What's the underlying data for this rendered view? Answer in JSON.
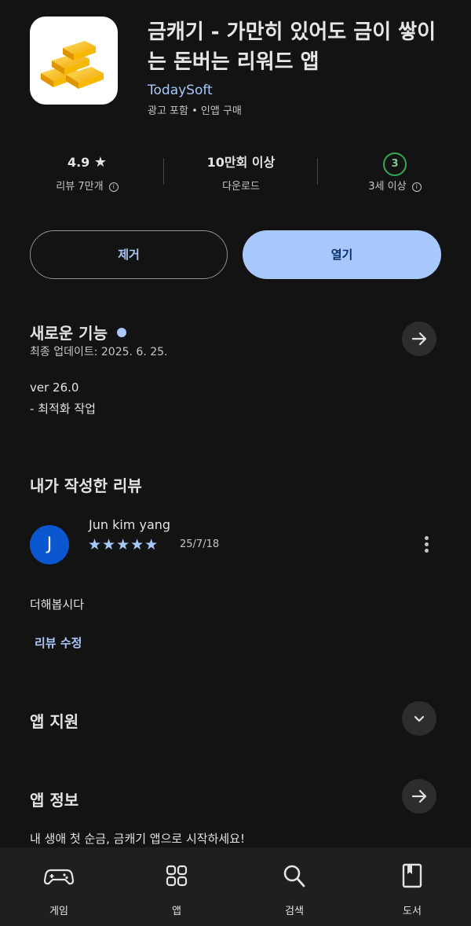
{
  "app": {
    "title": "금캐기 - 가만히 있어도 금이 쌓이는 돈버는 리워드 앱",
    "developer": "TodaySoft",
    "subtitle": "광고 포함 • 인앱 구매"
  },
  "stats": {
    "rating": "4.9",
    "rating_star": "★",
    "reviews_label": "리뷰 7만개",
    "downloads": "10만회 이상",
    "downloads_label": "다운로드",
    "age_badge": "3",
    "age_label": "3세 이상",
    "info_glyph": "i"
  },
  "buttons": {
    "remove": "제거",
    "open": "열기"
  },
  "whats_new": {
    "heading": "새로운 기능",
    "updated": "최종 업데이트: 2025. 6. 25.",
    "version": "ver 26.0",
    "note": "- 최적화 작업"
  },
  "my_review": {
    "heading": "내가 작성한 리뷰",
    "avatar_letter": "J",
    "reviewer": "Jun kim yang",
    "stars": "★★★★★",
    "rating": 5,
    "date": "25/7/18",
    "text": "더해봅시다",
    "edit_link": "리뷰 수정"
  },
  "app_support": {
    "heading": "앱 지원"
  },
  "app_info": {
    "heading": "앱 정보",
    "description": "내 생애 첫 순금, 금캐기 앱으로 시작하세요!"
  },
  "nav": {
    "games": "게임",
    "apps": "앱",
    "search": "검색",
    "books": "도서"
  },
  "colors": {
    "background": "#131313",
    "accent": "#a8c7fa",
    "navbar": "#1f1f1f",
    "age_green": "#34a853"
  }
}
